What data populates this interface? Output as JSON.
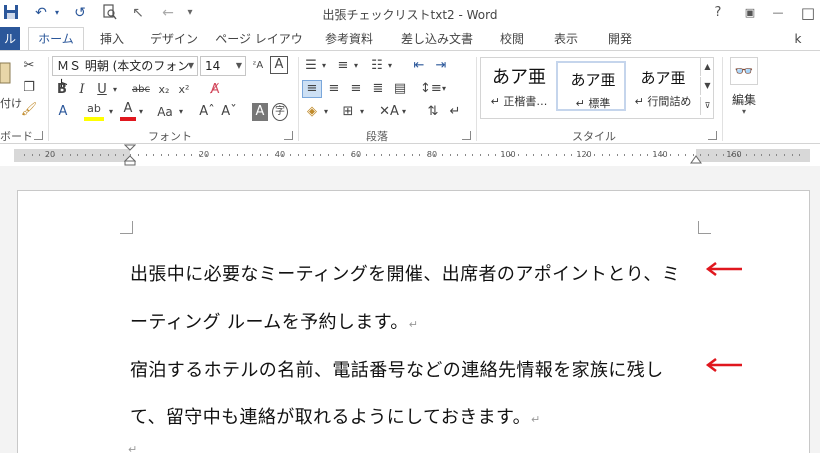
{
  "window": {
    "title": "出張チェックリストtxt2 - Word",
    "controls": {
      "help": "?",
      "restore_ribbon": "▣",
      "minimize": "—",
      "maximize": "□",
      "close": "✕"
    }
  },
  "tabs": [
    "ル",
    "ホーム",
    "挿入",
    "デザイン",
    "ページ レイアウト",
    "参考資料",
    "差し込み文書",
    "校閲",
    "表示",
    "開発"
  ],
  "account": "k",
  "ribbon": {
    "clipboard": {
      "paste_label": "付け",
      "group": "ボード"
    },
    "font": {
      "name": "ＭＳ 明朝 (本文のフォント",
      "size": "14",
      "group": "フォント"
    },
    "paragraph": {
      "group": "段落"
    },
    "styles": {
      "group": "スタイル",
      "items": [
        {
          "preview": "あア亜",
          "name": "↵ 正楷書…"
        },
        {
          "preview": "あア亜",
          "name": "↵ 標準"
        },
        {
          "preview": "あア亜",
          "name": "↵ 行間詰め"
        }
      ]
    },
    "editing": {
      "label": "編集"
    }
  },
  "ruler": {
    "labels": [
      "20",
      "20",
      "40",
      "60",
      "80",
      "100",
      "120",
      "140",
      "160"
    ]
  },
  "document": {
    "lines": [
      "出張中に必要なミーティングを開催、出席者のアポイントとり、ミ",
      "ーティング ルームを予約します。",
      "宿泊するホテルの名前、電話番号などの連絡先情報を家族に残し",
      "て、留守中も連絡が取れるようにしておきます。"
    ],
    "para_mark": "↵"
  },
  "annotations": {
    "arrow_color": "#e0171e"
  }
}
